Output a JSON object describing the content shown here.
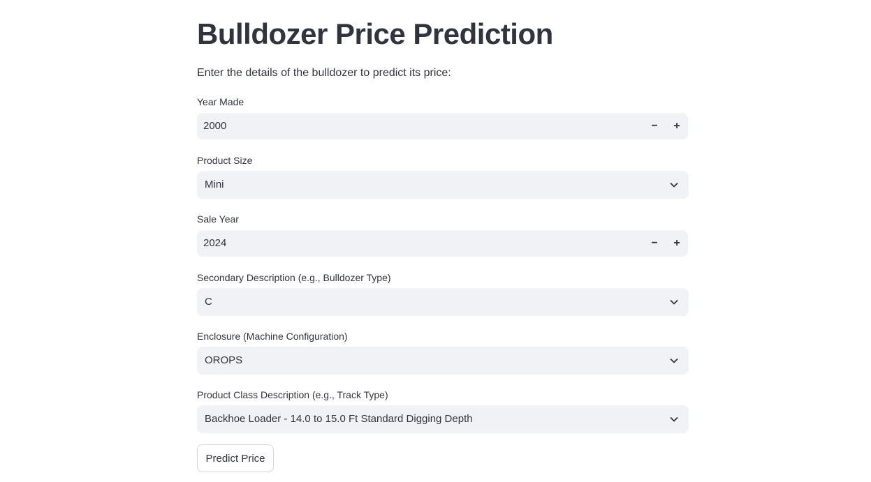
{
  "page": {
    "title": "Bulldozer Price Prediction",
    "intro": "Enter the details of the bulldozer to predict its price:"
  },
  "form": {
    "year_made": {
      "label": "Year Made",
      "value": "2000",
      "minus": "−",
      "plus": "+"
    },
    "product_size": {
      "label": "Product Size",
      "value": "Mini"
    },
    "sale_year": {
      "label": "Sale Year",
      "value": "2024",
      "minus": "−",
      "plus": "+"
    },
    "secondary_description": {
      "label": "Secondary Description (e.g., Bulldozer Type)",
      "value": "C"
    },
    "enclosure": {
      "label": "Enclosure (Machine Configuration)",
      "value": "OROPS"
    },
    "product_class": {
      "label": "Product Class Description (e.g., Track Type)",
      "value": "Backhoe Loader - 14.0 to 15.0 Ft Standard Digging Depth"
    }
  },
  "actions": {
    "predict_label": "Predict Price"
  },
  "icons": {
    "select_chevron": "chevron-down-icon",
    "decrement": "minus-icon",
    "increment": "plus-icon"
  },
  "colors": {
    "text": "#31333f",
    "input_background": "#f0f2f6",
    "button_border": "#d6d6d9",
    "page_background": "#ffffff"
  }
}
